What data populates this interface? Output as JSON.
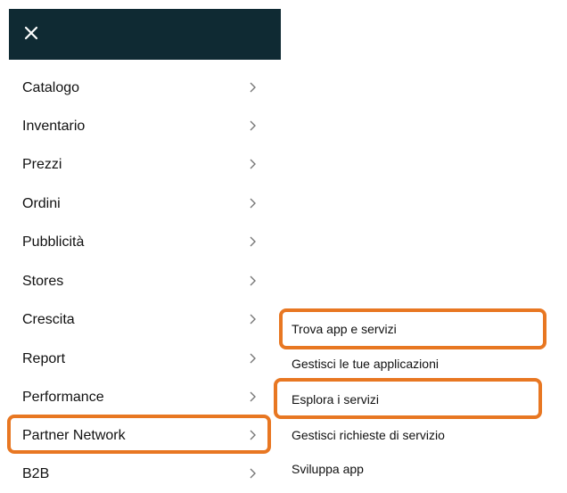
{
  "header": {
    "close_icon": "close-icon",
    "background": "#0f2a33"
  },
  "nav": {
    "items": [
      {
        "label": "Catalogo"
      },
      {
        "label": "Inventario"
      },
      {
        "label": "Prezzi"
      },
      {
        "label": "Ordini"
      },
      {
        "label": "Pubblicità"
      },
      {
        "label": "Stores"
      },
      {
        "label": "Crescita"
      },
      {
        "label": "Report"
      },
      {
        "label": "Performance"
      },
      {
        "label": "Partner Network",
        "highlighted": true
      },
      {
        "label": "B2B"
      }
    ],
    "chevron_icon": "chevron-right-icon"
  },
  "submenu": {
    "items": [
      {
        "label": "Trova app e servizi",
        "highlighted": true
      },
      {
        "label": "Gestisci le tue applicazioni"
      },
      {
        "label": "Esplora i servizi",
        "highlighted": true
      },
      {
        "label": "Gestisci richieste di servizio"
      },
      {
        "label": "Sviluppa app"
      }
    ]
  },
  "highlight_color": "#e87722"
}
